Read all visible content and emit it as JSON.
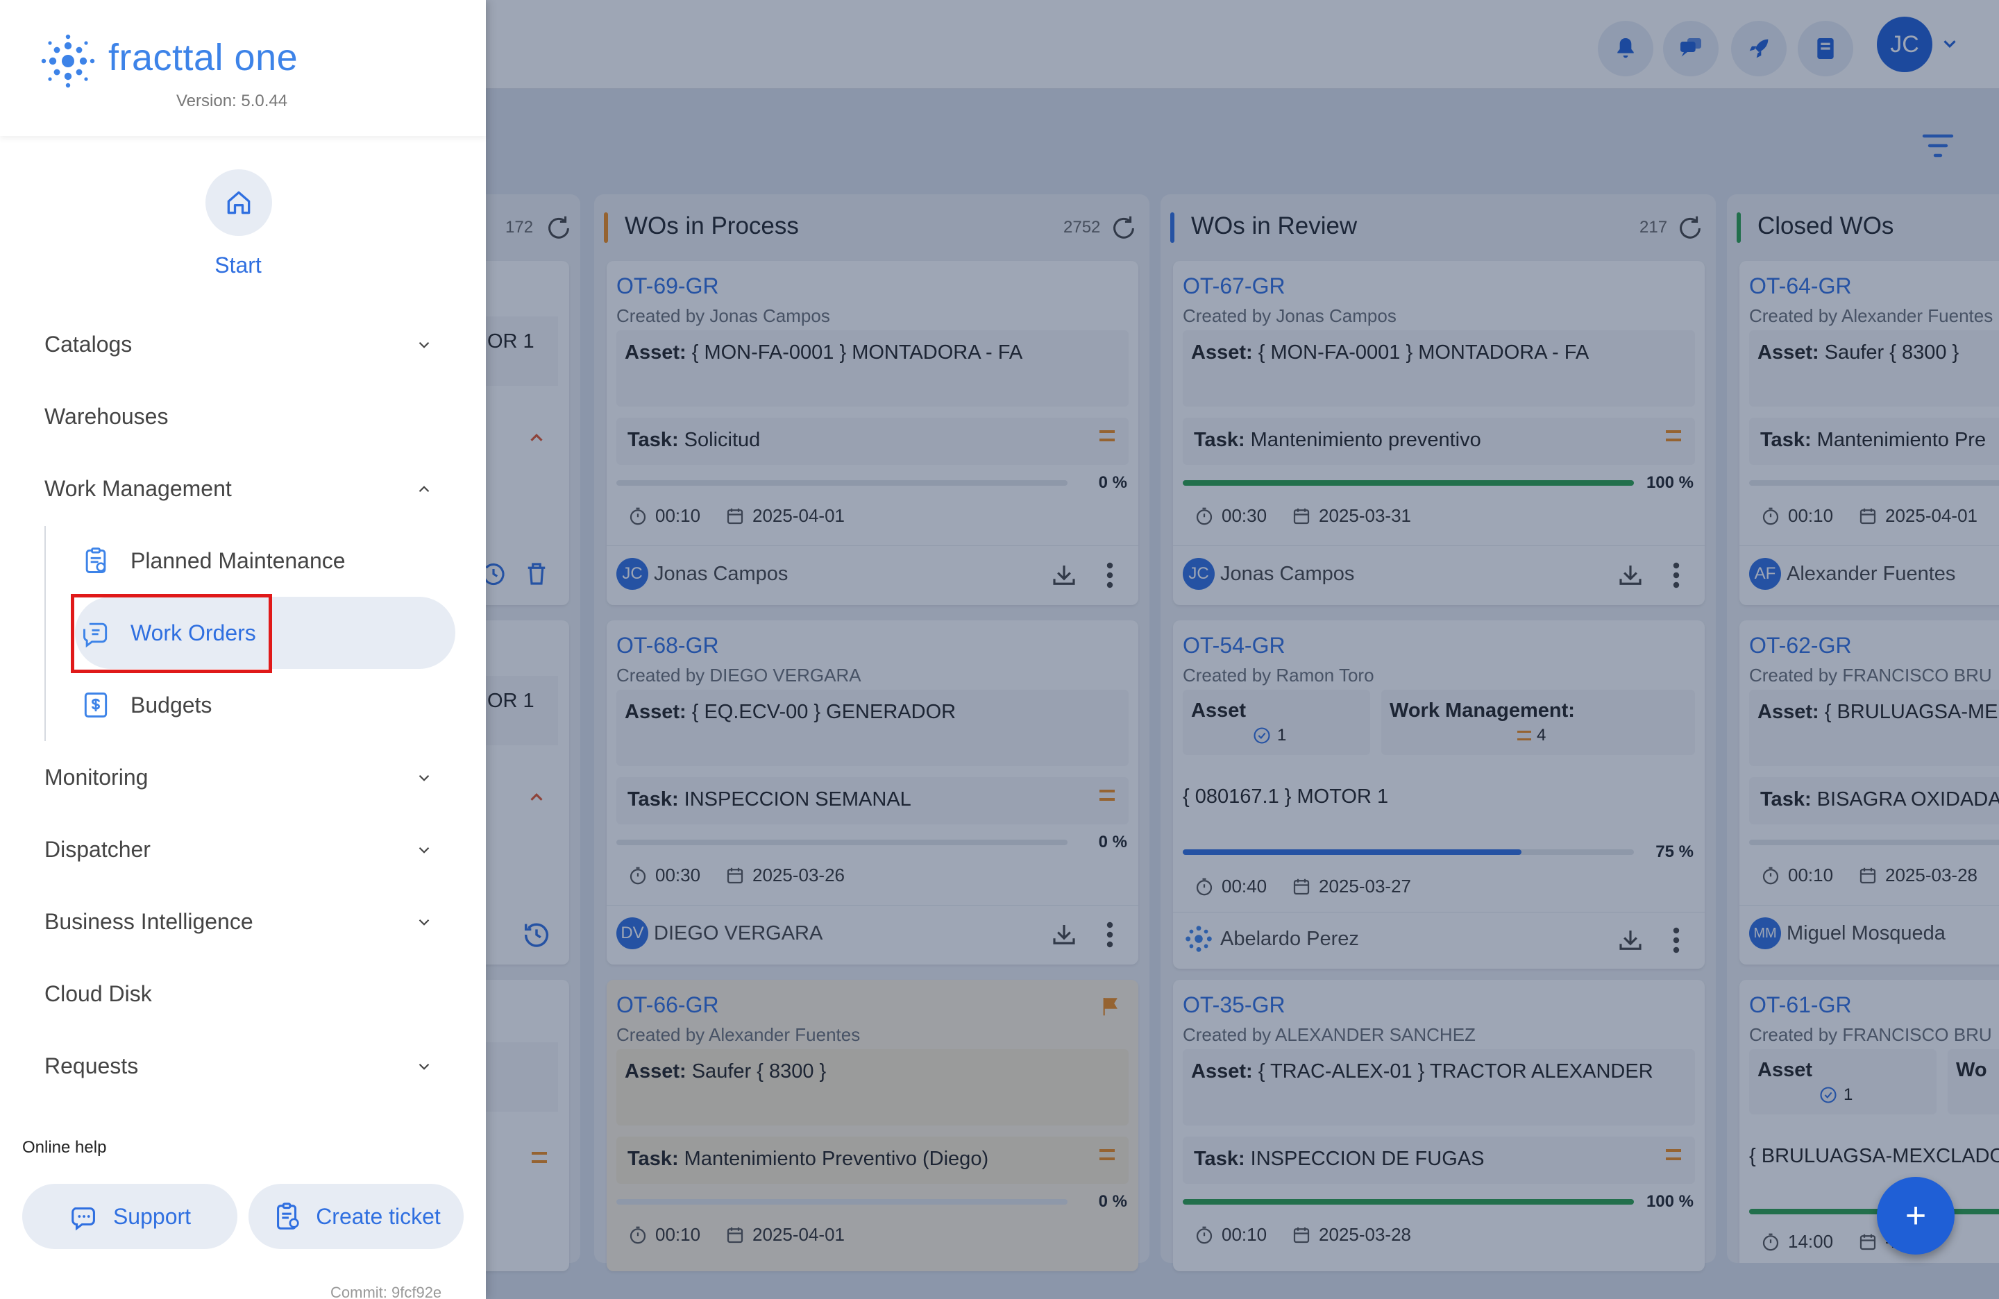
{
  "app": {
    "logo_text": "fracttal one",
    "version": "Version: 5.0.44",
    "commit": "Commit: 9fcf92e"
  },
  "topbar": {
    "user_initials": "JC",
    "icons": [
      "bell-icon",
      "chat-icon",
      "rocket-icon",
      "book-icon"
    ]
  },
  "sidebar": {
    "start_label": "Start",
    "items": [
      {
        "label": "Catalogs",
        "expandable": true
      },
      {
        "label": "Warehouses",
        "expandable": false
      },
      {
        "label": "Work Management",
        "expandable": true,
        "expanded": true
      },
      {
        "label": "Monitoring",
        "expandable": true
      },
      {
        "label": "Dispatcher",
        "expandable": true
      },
      {
        "label": "Business Intelligence",
        "expandable": true
      },
      {
        "label": "Cloud Disk",
        "expandable": false
      },
      {
        "label": "Requests",
        "expandable": true
      }
    ],
    "subitems": [
      {
        "label": "Planned Maintenance"
      },
      {
        "label": "Work Orders",
        "active": true
      },
      {
        "label": "Budgets"
      }
    ],
    "online_help": "Online help",
    "support_label": "Support",
    "create_ticket_label": "Create ticket"
  },
  "board": {
    "columns": [
      {
        "title": "",
        "count": "172",
        "color": "#999999"
      },
      {
        "title": "WOs in Process",
        "count": "2752",
        "color": "#ef8c1c"
      },
      {
        "title": "WOs in Review",
        "count": "217",
        "color": "#2f6fe0"
      },
      {
        "title": "Closed WOs",
        "count": "",
        "color": "#2aa14a"
      }
    ],
    "partial_left_texts": [
      "OR 1",
      "OR 1"
    ],
    "process_cards": [
      {
        "id": "OT-69-GR",
        "created_by": "Created by Jonas Campos",
        "asset_label": "Asset:",
        "asset": "{ MON-FA-0001 } MONTADORA - FA",
        "task_label": "Task:",
        "task": "Solicitud",
        "progress": 0,
        "progress_text": "0 %",
        "time": "00:10",
        "date": "2025-04-01",
        "user_initials": "JC",
        "user": "Jonas Campos"
      },
      {
        "id": "OT-68-GR",
        "created_by": "Created by DIEGO VERGARA",
        "asset_label": "Asset:",
        "asset": "{ EQ.ECV-00 } GENERADOR",
        "task_label": "Task:",
        "task": "INSPECCION SEMANAL",
        "progress": 0,
        "progress_text": "0 %",
        "time": "00:30",
        "date": "2025-03-26",
        "user_initials": "DV",
        "user": "DIEGO VERGARA"
      },
      {
        "id": "OT-66-GR",
        "created_by": "Created by Alexander Fuentes",
        "asset_label": "Asset:",
        "asset": "Saufer { 8300 }",
        "task_label": "Task:",
        "task": "Mantenimiento Preventivo (Diego)",
        "progress": 0,
        "progress_text": "0 %",
        "time": "00:10",
        "date": "2025-04-01"
      }
    ],
    "review_cards": [
      {
        "id": "OT-67-GR",
        "created_by": "Created by Jonas Campos",
        "asset_label": "Asset:",
        "asset": "{ MON-FA-0001 } MONTADORA - FA",
        "task_label": "Task:",
        "task": "Mantenimiento preventivo",
        "progress": 100,
        "progress_text": "100 %",
        "time": "00:30",
        "date": "2025-03-31",
        "user_initials": "JC",
        "user": "Jonas Campos"
      },
      {
        "id": "OT-54-GR",
        "created_by": "Created by Ramon Toro",
        "sub_asset_title": "Asset",
        "sub_asset_count": "1",
        "sub_wm_title": "Work Management:",
        "sub_wm_count": "4",
        "asset_line": "{ 080167.1 } MOTOR 1",
        "progress": 75,
        "progress_text": "75 %",
        "time": "00:40",
        "date": "2025-03-27",
        "user": "Abelardo Perez"
      },
      {
        "id": "OT-35-GR",
        "created_by": "Created by ALEXANDER SANCHEZ",
        "asset_label": "Asset:",
        "asset": "{ TRAC-ALEX-01 } TRACTOR ALEXANDER",
        "task_label": "Task:",
        "task": "INSPECCION DE FUGAS",
        "progress": 100,
        "progress_text": "100 %",
        "time": "00:10",
        "date": "2025-03-28"
      }
    ],
    "closed_cards": [
      {
        "id": "OT-64-GR",
        "created_by": "Created by Alexander Fuentes",
        "asset_label": "Asset:",
        "asset": "Saufer { 8300 }",
        "task_label": "Task:",
        "task": "Mantenimiento Pre",
        "time": "00:10",
        "date": "2025-04-01",
        "user_initials": "AF",
        "user": "Alexander Fuentes"
      },
      {
        "id": "OT-62-GR",
        "created_by": "Created by FRANCISCO BRU",
        "asset_label": "Asset:",
        "asset": "{ BRULUAGSA-ME",
        "task_label": "Task:",
        "task": "BISAGRA OXIDADA",
        "time": "00:10",
        "date": "2025-03-28",
        "user_initials": "MM",
        "user": "Miguel Mosqueda"
      },
      {
        "id": "OT-61-GR",
        "created_by": "Created by FRANCISCO BRU",
        "sub_asset_title": "Asset",
        "sub_asset_count": "1",
        "sub_wm_title": "Wo",
        "asset_line": "{ BRULUAGSA-MEXCLADO",
        "time": "14:00",
        "date": "-28"
      }
    ],
    "fab_label": "+"
  },
  "colors": {
    "accent": "#2f6fe0",
    "progress_green": "#2aa14a",
    "progress_blue": "#2f6fe0",
    "warning": "#ef8c1c",
    "highlight": "#e01919"
  }
}
